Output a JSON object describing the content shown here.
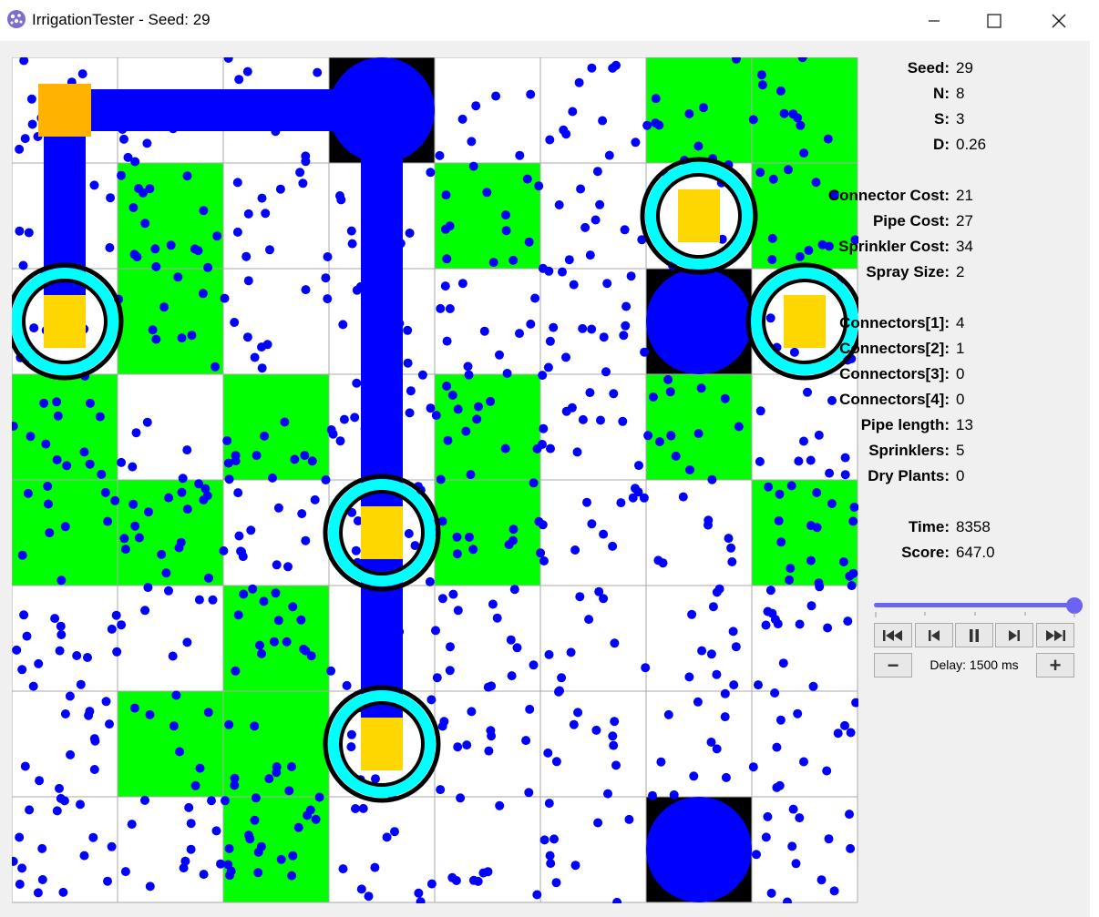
{
  "window": {
    "title": "IrrigationTester - Seed: 29",
    "minimize_label": "—",
    "maximize_label": "☐",
    "close_label": "✕"
  },
  "stats": [
    {
      "label": "Seed:",
      "value": "29"
    },
    {
      "label": "N:",
      "value": "8"
    },
    {
      "label": "S:",
      "value": "3"
    },
    {
      "label": "D:",
      "value": "0.26"
    },
    {
      "label": "Connector Cost:",
      "value": "21"
    },
    {
      "label": "Pipe Cost:",
      "value": "27"
    },
    {
      "label": "Sprinkler Cost:",
      "value": "34"
    },
    {
      "label": "Spray Size:",
      "value": "2"
    },
    {
      "label": "Connectors[1]:",
      "value": "4"
    },
    {
      "label": "Connectors[2]:",
      "value": "1"
    },
    {
      "label": "Connectors[3]:",
      "value": "0"
    },
    {
      "label": "Connectors[4]:",
      "value": "0"
    },
    {
      "label": "Pipe length:",
      "value": "13"
    },
    {
      "label": "Sprinklers:",
      "value": "5"
    },
    {
      "label": "Dry Plants:",
      "value": "0"
    },
    {
      "label": "Time:",
      "value": "8358"
    },
    {
      "label": "Score:",
      "value": "647.0"
    }
  ],
  "playback": {
    "slider_position": 1.0,
    "delay_label": "Delay: 1500 ms",
    "first_icon": "skip-first-icon",
    "prev_icon": "step-back-icon",
    "pause_icon": "pause-icon",
    "next_icon": "step-forward-icon",
    "last_icon": "skip-last-icon",
    "minus_label": "−",
    "plus_label": "+"
  },
  "board": {
    "grid_size": 8,
    "green_cells": [
      [
        0,
        6
      ],
      [
        0,
        7
      ],
      [
        1,
        1
      ],
      [
        1,
        4
      ],
      [
        1,
        7
      ],
      [
        2,
        1
      ],
      [
        3,
        0
      ],
      [
        3,
        2
      ],
      [
        3,
        4
      ],
      [
        3,
        6
      ],
      [
        4,
        0
      ],
      [
        4,
        1
      ],
      [
        4,
        4
      ],
      [
        4,
        7
      ],
      [
        5,
        2
      ],
      [
        6,
        1
      ],
      [
        6,
        2
      ],
      [
        7,
        2
      ]
    ],
    "source_cells": [
      [
        0,
        3
      ],
      [
        2,
        6
      ],
      [
        7,
        6
      ]
    ],
    "sprinkler_cells": [
      [
        2,
        0
      ],
      [
        1,
        6
      ],
      [
        2,
        7
      ],
      [
        4,
        3
      ],
      [
        6,
        3
      ]
    ],
    "connector_cells": [
      [
        0,
        0
      ]
    ],
    "pipes": [
      [
        [
          0,
          0
        ],
        [
          0,
          3
        ]
      ],
      [
        [
          0,
          0
        ],
        [
          2,
          0
        ]
      ],
      [
        [
          0,
          3
        ],
        [
          6,
          3
        ]
      ]
    ],
    "colors": {
      "grass": "#00ff00",
      "empty": "#ffffff",
      "source_bg": "#000000",
      "water": "#0000ff",
      "sprinkler": "#ffd700",
      "connector": "#ffb300",
      "ring": "#00ffff"
    }
  }
}
